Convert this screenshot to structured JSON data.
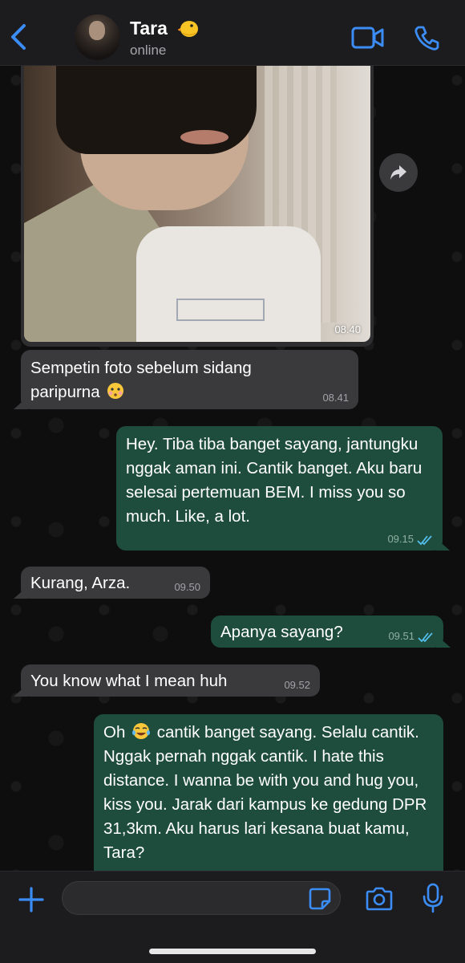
{
  "header": {
    "contact_name": "Tara",
    "status": "online",
    "accent_color": "#3b8df5"
  },
  "messages": [
    {
      "type": "image",
      "direction": "incoming",
      "time": "08.40"
    },
    {
      "type": "text",
      "direction": "incoming",
      "line1": "Sempetin foto sebelum sidang",
      "line2": "paripurna",
      "time": "08.41"
    },
    {
      "type": "text",
      "direction": "outgoing",
      "text": "Hey. Tiba tiba banget sayang, jantungku nggak aman ini. Cantik banget. Aku baru selesai pertemuan BEM. I miss you so much. Like, a lot.",
      "time": "09.15",
      "status": "read"
    },
    {
      "type": "text",
      "direction": "incoming",
      "text": "Kurang, Arza.",
      "time": "09.50"
    },
    {
      "type": "text",
      "direction": "outgoing",
      "text": "Apanya sayang?",
      "time": "09.51",
      "status": "read"
    },
    {
      "type": "text",
      "direction": "incoming",
      "text": "You know what I mean huh",
      "time": "09.52"
    },
    {
      "type": "text",
      "direction": "outgoing",
      "prefix": "Oh",
      "text": "cantik banget sayang. Selalu cantik. Nggak pernah nggak cantik. I hate this distance. I wanna be with you and hug you, kiss you. Jarak dari kampus ke gedung DPR 31,3km. Aku harus lari kesana buat kamu, Tara?"
    }
  ],
  "input": {
    "placeholder": ""
  },
  "colors": {
    "incoming_bubble": "#3a3a3c",
    "outgoing_bubble": "#1f4d3d",
    "read_ticks": "#53bdeb"
  }
}
